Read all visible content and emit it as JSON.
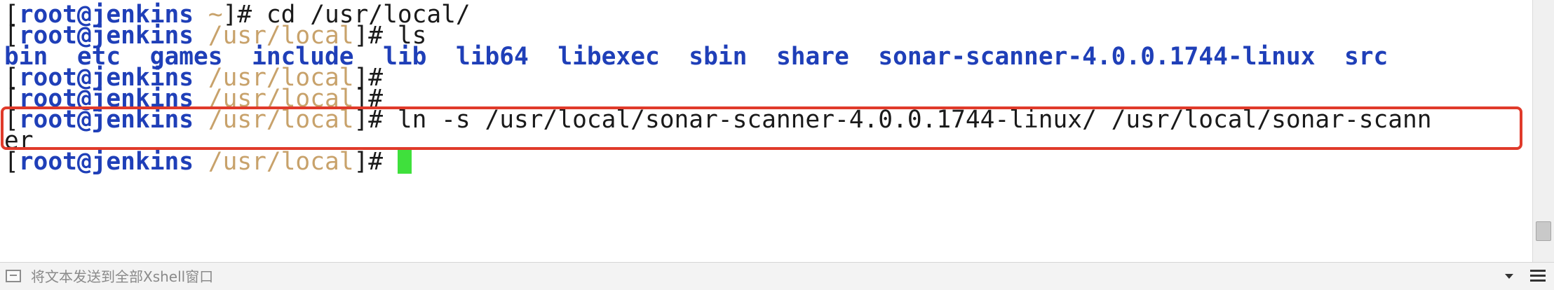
{
  "terminal": {
    "prompt_user": "root@jenkins",
    "lines": [
      {
        "home_path": "~",
        "command": "cd /usr/local/"
      },
      {
        "path": "/usr/local",
        "command": "ls"
      },
      {
        "path": "/usr/local",
        "command": ""
      },
      {
        "path": "/usr/local",
        "command": ""
      },
      {
        "path": "/usr/local",
        "command": "ln -s /usr/local/sonar-scanner-4.0.0.1744-linux/ /usr/local/sonar-scann",
        "wrap": "er"
      },
      {
        "path": "/usr/local",
        "command": ""
      }
    ],
    "ls_output": [
      "bin",
      "etc",
      "games",
      "include",
      "lib",
      "lib64",
      "libexec",
      "sbin",
      "share",
      "sonar-scanner-4.0.0.1744-linux",
      "src"
    ],
    "colors": {
      "user": "#1f3fb8",
      "path": "#c8a26b",
      "directory": "#1f3fb8",
      "cursor": "#3fe03c",
      "highlight_border": "#e03a2a"
    }
  },
  "statusbar": {
    "send_placeholder": "将文本发送到全部Xshell窗口",
    "send_icon": "send-to-all-icon",
    "dropdown_icon": "chevron-down-icon",
    "menu_icon": "hamburger-menu-icon"
  }
}
